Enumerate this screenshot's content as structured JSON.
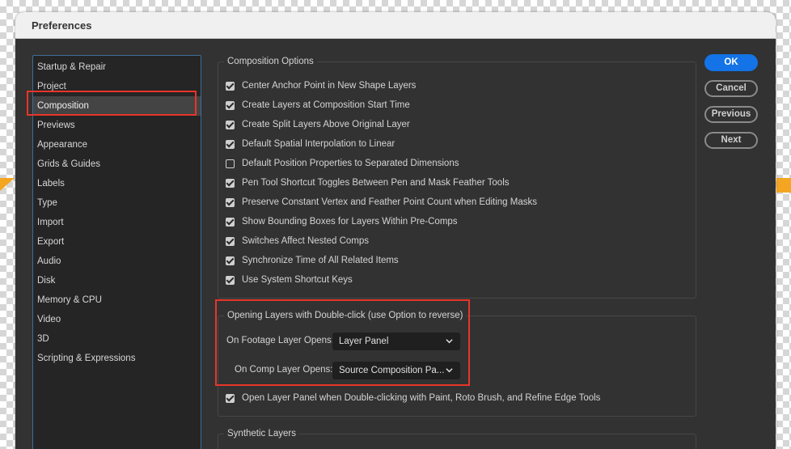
{
  "window": {
    "title": "Preferences"
  },
  "sidebar": {
    "items": [
      {
        "label": "Startup & Repair"
      },
      {
        "label": "Project"
      },
      {
        "label": "Composition",
        "selected": true
      },
      {
        "label": "Previews"
      },
      {
        "label": "Appearance"
      },
      {
        "label": "Grids & Guides"
      },
      {
        "label": "Labels"
      },
      {
        "label": "Type"
      },
      {
        "label": "Import"
      },
      {
        "label": "Export"
      },
      {
        "label": "Audio"
      },
      {
        "label": "Disk"
      },
      {
        "label": "Memory & CPU"
      },
      {
        "label": "Video"
      },
      {
        "label": "3D"
      },
      {
        "label": "Scripting & Expressions"
      }
    ]
  },
  "composition_options": {
    "legend": "Composition Options",
    "options": [
      {
        "label": "Center Anchor Point in New Shape Layers",
        "checked": true
      },
      {
        "label": "Create Layers at Composition Start Time",
        "checked": true
      },
      {
        "label": "Create Split Layers Above Original Layer",
        "checked": true
      },
      {
        "label": "Default Spatial Interpolation to Linear",
        "checked": true
      },
      {
        "label": "Default Position Properties to Separated Dimensions",
        "checked": false
      },
      {
        "label": "Pen Tool Shortcut Toggles Between Pen and Mask Feather Tools",
        "checked": true
      },
      {
        "label": "Preserve Constant Vertex and Feather Point Count when Editing Masks",
        "checked": true
      },
      {
        "label": "Show Bounding Boxes for Layers Within Pre-Comps",
        "checked": true
      },
      {
        "label": "Switches Affect Nested Comps",
        "checked": true
      },
      {
        "label": "Synchronize Time of All Related Items",
        "checked": true
      },
      {
        "label": "Use System Shortcut Keys",
        "checked": true
      }
    ]
  },
  "opening_layers": {
    "legend": "Opening Layers with Double-click (use Option to reverse)",
    "footage_label": "On Footage Layer Opens:",
    "footage_value": "Layer Panel",
    "comp_label": "On Comp Layer Opens:",
    "comp_value": "Source Composition Pa...",
    "paint_option": {
      "label": "Open Layer Panel when Double-clicking with Paint, Roto Brush, and Refine Edge Tools",
      "checked": true
    }
  },
  "synthetic_layers": {
    "legend": "Synthetic Layers"
  },
  "buttons": {
    "ok": "OK",
    "cancel": "Cancel",
    "previous": "Previous",
    "next": "Next"
  },
  "colors": {
    "accent": "#1473e6",
    "highlight": "#e8352a",
    "background": "#323232"
  }
}
